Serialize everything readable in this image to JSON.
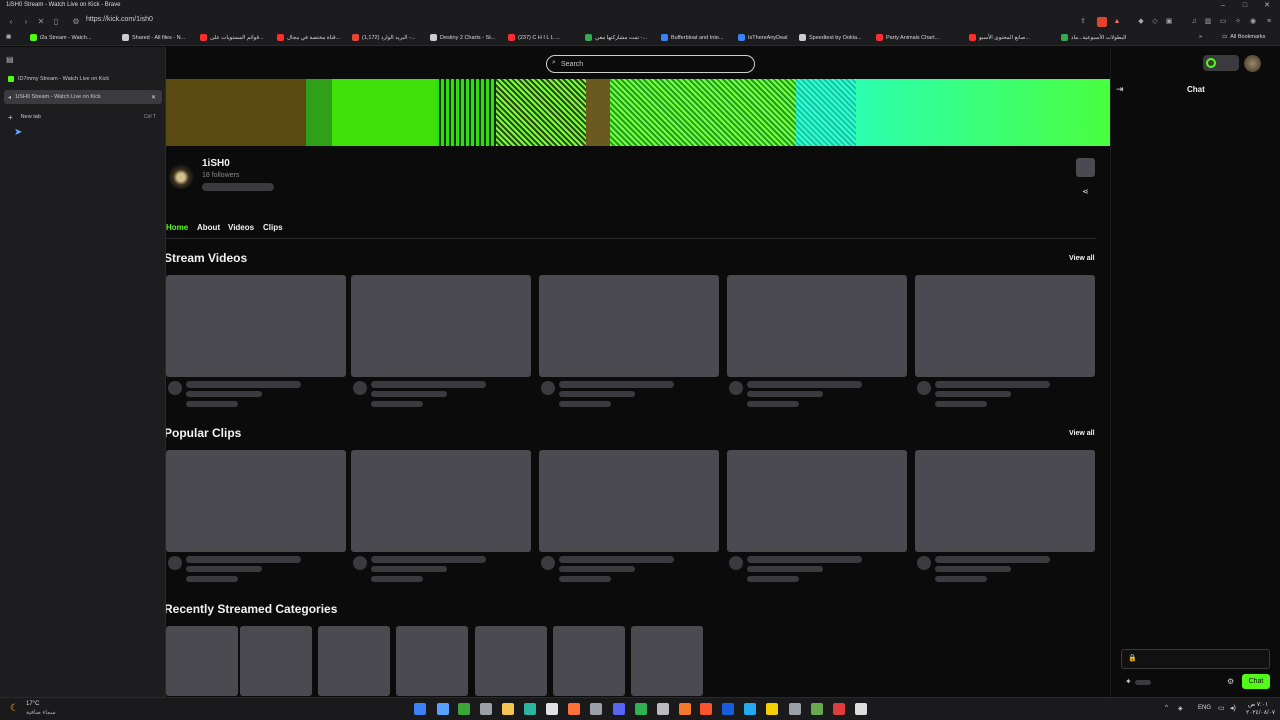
{
  "window": {
    "title": "1iSH0 Stream - Watch Live on Kick - Brave"
  },
  "address_bar": {
    "url": "https://kick.com/1ish0"
  },
  "bookmarks": [
    {
      "label": "i2a Stream - Watch...",
      "color": "#53fc18"
    },
    {
      "label": "Shared - All files - N...",
      "color": "#cccccc"
    },
    {
      "label": "قوائم المستويات على...",
      "color": "#ff2d2d"
    },
    {
      "label": "قناة مختصة في مجال...",
      "color": "#ff2d2d"
    },
    {
      "label": "(1,172) البريد الوارد -...",
      "color": "#ea4335"
    },
    {
      "label": "Destiny 2 Charts - St...",
      "color": "#cccccc"
    },
    {
      "label": "(237) C H I L L ...",
      "color": "#ff2d2d"
    },
    {
      "label": "تمت مشاركتها معي -...",
      "color": "#34a853"
    },
    {
      "label": "Bufferbloat and Inte...",
      "color": "#3b82f6"
    },
    {
      "label": "IsThereAnyDeal",
      "color": "#3b82f6"
    },
    {
      "label": "Speedtest by Ookla...",
      "color": "#cccccc"
    },
    {
      "label": "Party Animals Chart...",
      "color": "#ff2d2d"
    },
    {
      "label": "صانع المحتوى الأسبو...",
      "color": "#ff2d2d"
    },
    {
      "label": "البطولات الأسبوعية...ماد",
      "color": "#34a853"
    }
  ],
  "all_bookmarks_label": "All Bookmarks",
  "sidebar": {
    "tabs": [
      {
        "label": "ID7mmy Stream - Watch Live on Kick",
        "active": false
      },
      {
        "label": "1iSH0 Stream - Watch Live on Kick",
        "active": true
      }
    ],
    "new_tab_label": "New tab",
    "new_tab_shortcut": "Ctrl  T"
  },
  "page": {
    "search_placeholder": "Search",
    "channel_name": "1iSH0",
    "followers": "18 followers",
    "nav_tabs": [
      "Home",
      "About",
      "Videos",
      "Clips"
    ],
    "active_nav": "Home",
    "sections": {
      "stream_videos": "Stream Videos",
      "popular_clips": "Popular Clips",
      "recent_categories": "Recently Streamed Categories",
      "view_all": "View all"
    },
    "accent_color": "#53fc18"
  },
  "chat": {
    "title": "Chat",
    "send_label": "Chat"
  },
  "taskbar": {
    "weather_temp": "17°C",
    "weather_desc": "سماء صافية",
    "language": "ENG",
    "time": "٧:٠١ ص",
    "date": "٢٠٢٤/٠٨/٠٧"
  }
}
